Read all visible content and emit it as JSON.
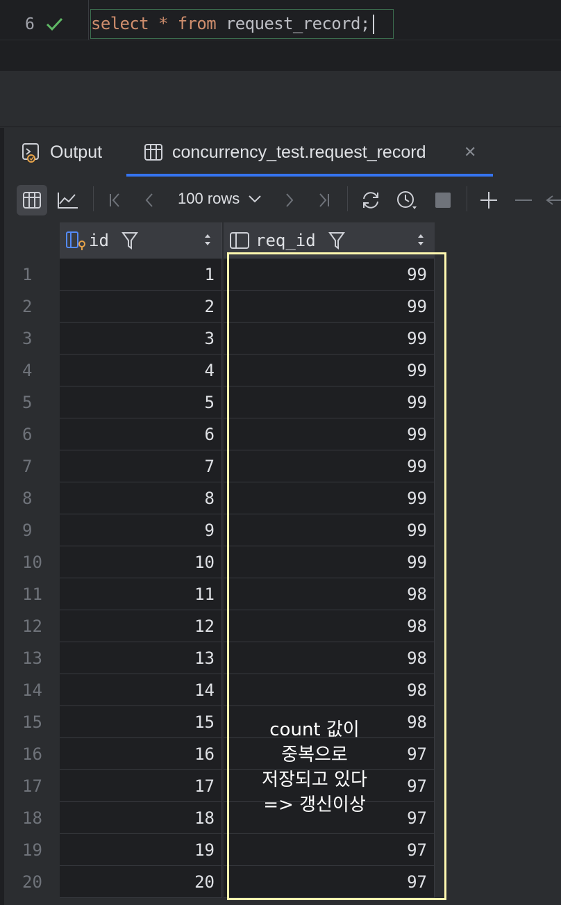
{
  "editor": {
    "line_number": "6",
    "code": {
      "kw1": "select",
      "star": "*",
      "kw2": "from",
      "table": "request_record",
      "semicolon": ";"
    }
  },
  "tabs": [
    {
      "label": "Output",
      "icon": "console-output-icon"
    },
    {
      "label": "concurrency_test.request_record",
      "icon": "table-icon",
      "active": true
    }
  ],
  "toolbar": {
    "rows_label": "100 rows"
  },
  "grid": {
    "columns": [
      {
        "name": "id",
        "icon": "primary-key-column-icon"
      },
      {
        "name": "req_id",
        "icon": "column-icon"
      }
    ],
    "rows": [
      {
        "n": "1",
        "id": "1",
        "req_id": "99"
      },
      {
        "n": "2",
        "id": "2",
        "req_id": "99"
      },
      {
        "n": "3",
        "id": "3",
        "req_id": "99"
      },
      {
        "n": "4",
        "id": "4",
        "req_id": "99"
      },
      {
        "n": "5",
        "id": "5",
        "req_id": "99"
      },
      {
        "n": "6",
        "id": "6",
        "req_id": "99"
      },
      {
        "n": "7",
        "id": "7",
        "req_id": "99"
      },
      {
        "n": "8",
        "id": "8",
        "req_id": "99"
      },
      {
        "n": "9",
        "id": "9",
        "req_id": "99"
      },
      {
        "n": "10",
        "id": "10",
        "req_id": "99"
      },
      {
        "n": "11",
        "id": "11",
        "req_id": "98"
      },
      {
        "n": "12",
        "id": "12",
        "req_id": "98"
      },
      {
        "n": "13",
        "id": "13",
        "req_id": "98"
      },
      {
        "n": "14",
        "id": "14",
        "req_id": "98"
      },
      {
        "n": "15",
        "id": "15",
        "req_id": "98"
      },
      {
        "n": "16",
        "id": "16",
        "req_id": "97"
      },
      {
        "n": "17",
        "id": "17",
        "req_id": "97"
      },
      {
        "n": "18",
        "id": "18",
        "req_id": "97"
      },
      {
        "n": "19",
        "id": "19",
        "req_id": "97"
      },
      {
        "n": "20",
        "id": "20",
        "req_id": "97"
      }
    ]
  },
  "annotation": {
    "lines": [
      "count 값이",
      "중복으로",
      "저장되고 있다",
      "=> 갱신이상"
    ],
    "color": "#fff8b0"
  },
  "colors": {
    "accent": "#3574f0",
    "keyword": "#cf8e6d",
    "success": "#5fb865"
  }
}
